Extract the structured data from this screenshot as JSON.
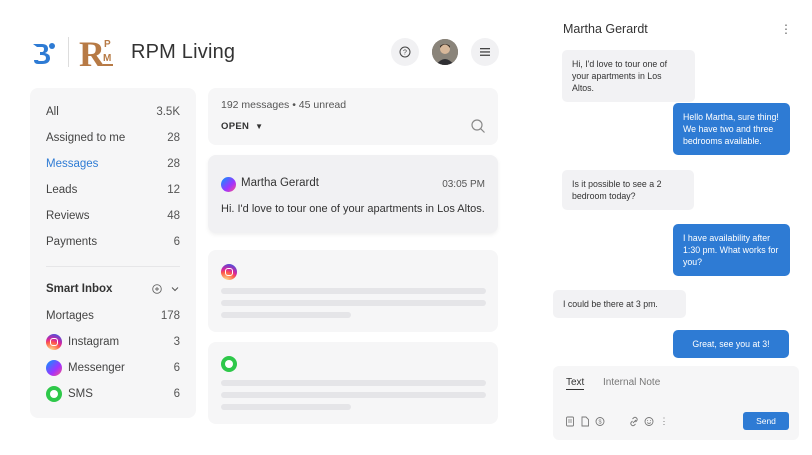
{
  "brand": {
    "name": "RPM Living",
    "logo_text": "RPM",
    "accent": "#2e7bd4",
    "logo_color": "#b77a45"
  },
  "header": {
    "help_icon": "help-circle-icon",
    "menu_icon": "hamburger-menu-icon"
  },
  "sidebar": {
    "items": [
      {
        "label": "All",
        "count": "3.5K"
      },
      {
        "label": "Assigned to me",
        "count": "28"
      },
      {
        "label": "Messages",
        "count": "28"
      },
      {
        "label": "Leads",
        "count": "12"
      },
      {
        "label": "Reviews",
        "count": "48"
      },
      {
        "label": "Payments",
        "count": "6"
      }
    ],
    "smart_inbox": {
      "title": "Smart Inbox",
      "items": [
        {
          "label": "Mortages",
          "count": "178"
        },
        {
          "label": "Instagram",
          "count": "3",
          "icon": "instagram-icon"
        },
        {
          "label": "Messenger",
          "count": "6",
          "icon": "messenger-icon"
        },
        {
          "label": "SMS",
          "count": "6",
          "icon": "sms-icon"
        }
      ]
    }
  },
  "filter": {
    "summary": "192 messages • 45 unread",
    "status": "OPEN"
  },
  "conversation": {
    "name": "Martha Gerardt",
    "time": "03:05 PM",
    "preview": "Hi. I'd love to tour one of your apartments in Los Altos."
  },
  "chat": {
    "contact": "Martha Gerardt",
    "messages": [
      {
        "dir": "in",
        "text": "Hi, I'd love to tour one of your apartments in Los Altos."
      },
      {
        "dir": "out",
        "text": "Hello Martha, sure thing! We have two and three bedrooms available."
      },
      {
        "dir": "in",
        "text": "Is it possible to see a 2 bedroom today?"
      },
      {
        "dir": "out",
        "text": "I have availability after 1:30 pm. What works for you?"
      },
      {
        "dir": "in",
        "text": "I could be there at 3 pm."
      },
      {
        "dir": "out",
        "text": "Great, see you at 3!"
      }
    ],
    "composer": {
      "tab_text": "Text",
      "tab_note": "Internal Note",
      "send": "Send"
    }
  }
}
